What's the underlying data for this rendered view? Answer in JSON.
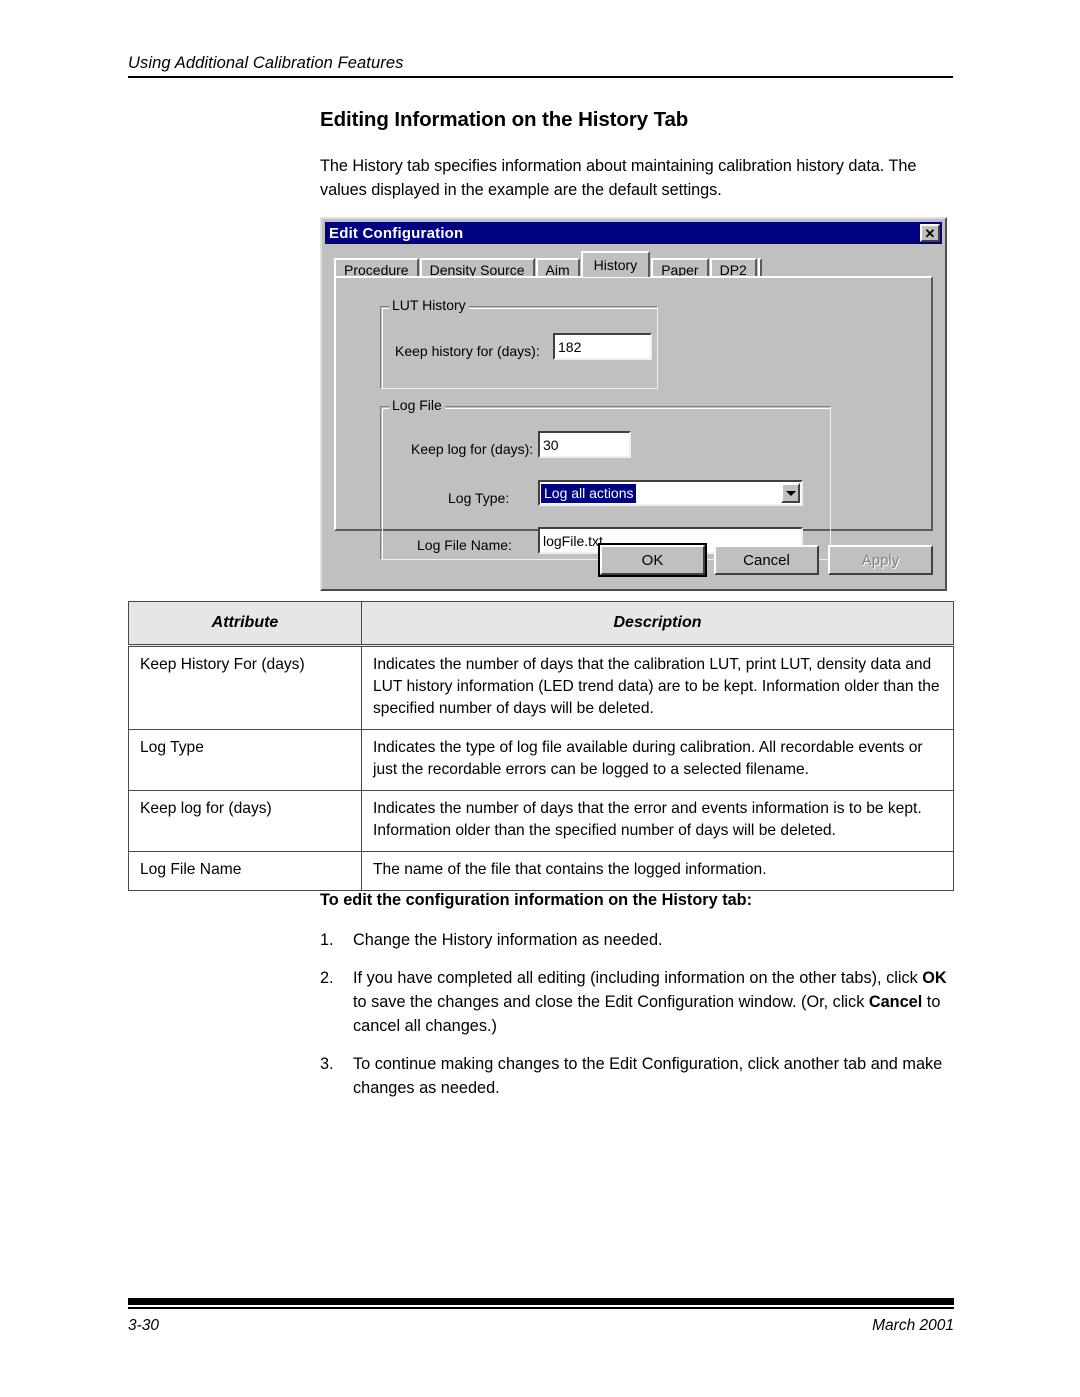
{
  "header": {
    "running_head": "Using Additional Calibration Features"
  },
  "section": {
    "title": "Editing Information on the History Tab",
    "intro": "The History tab specifies information about maintaining calibration history data. The values displayed in the example are the default settings."
  },
  "dialog": {
    "title": "Edit Configuration",
    "close_icon_label": "✕",
    "tabs": [
      {
        "label": "Procedure",
        "active": false
      },
      {
        "label": "Density Source",
        "active": false
      },
      {
        "label": "Aim",
        "active": false
      },
      {
        "label": "History",
        "active": true
      },
      {
        "label": "Paper",
        "active": false
      },
      {
        "label": "DP2",
        "active": false
      }
    ],
    "lut_history": {
      "legend": "LUT History",
      "keep_history_label": "Keep history for (days):",
      "keep_history_value": "182"
    },
    "log_file": {
      "legend": "Log File",
      "keep_log_label": "Keep log for (days):",
      "keep_log_value": "30",
      "log_type_label": "Log Type:",
      "log_type_value": "Log all actions",
      "log_file_name_label": "Log File Name:",
      "log_file_name_value": "logFile.txt"
    },
    "buttons": {
      "ok": "OK",
      "cancel": "Cancel",
      "apply": "Apply"
    },
    "colors": {
      "titlebar": "#000082",
      "face": "#c0c0c0",
      "selection": "#000082"
    }
  },
  "table": {
    "columns": [
      "Attribute",
      "Description"
    ],
    "rows": [
      {
        "attribute": "Keep History For (days)",
        "description": "Indicates the number of days that the calibration LUT, print LUT, density data and LUT history information (LED trend data) are to be kept. Information older than the specified number of days will be deleted."
      },
      {
        "attribute": "Log Type",
        "description": "Indicates the type of log file available during calibration. All recordable events or just the recordable errors can be logged to a selected filename."
      },
      {
        "attribute": "Keep log for (days)",
        "description": "Indicates the number of days that the error and events information is to be kept. Information older than the specified number of days will be deleted."
      },
      {
        "attribute": "Log File Name",
        "description": "The name of the file that contains the logged information."
      }
    ]
  },
  "procedure": {
    "title": "To edit the configuration information on the History tab:",
    "steps": [
      {
        "number": "1.",
        "html": "Change the History information as needed."
      },
      {
        "number": "2.",
        "html": "If you have completed all editing (including information on the other tabs), click <b>OK</b> to save the changes and close the Edit Configuration window. (Or, click <b>Cancel</b> to cancel all changes.)"
      },
      {
        "number": "3.",
        "html": "To continue making changes to the Edit Configuration, click another tab and make changes as needed."
      }
    ]
  },
  "footer": {
    "page_number": "3-30",
    "date": "March 2001"
  }
}
